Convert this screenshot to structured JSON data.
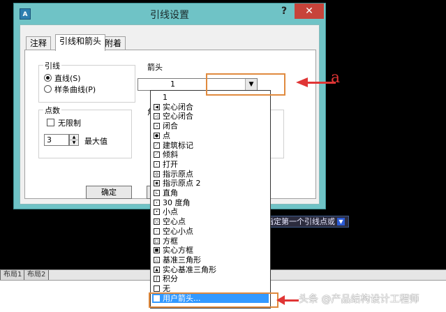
{
  "window": {
    "title": "引线设置",
    "help_label": "?",
    "close_label": "✕",
    "app_icon": "A"
  },
  "tabs": [
    {
      "label": "注释"
    },
    {
      "label": "引线和箭头"
    },
    {
      "label": "附着"
    }
  ],
  "leader_group": {
    "label": "引线",
    "options": [
      {
        "label": "直线(S)",
        "checked": true
      },
      {
        "label": "样条曲线(P)",
        "checked": false
      }
    ]
  },
  "count_group": {
    "label": "点数",
    "unlimited_label": "无限制",
    "unlimited_checked": false,
    "value": "3",
    "max_label": "最大值"
  },
  "arrow_group": {
    "label": "箭头",
    "combo_value": "1"
  },
  "angle_group": {
    "label_partial": "角"
  },
  "buttons": {
    "ok_label": "确定",
    "cancel_partial": ""
  },
  "dropdown": {
    "items": [
      {
        "label": "1",
        "icon": "none"
      },
      {
        "label": "实心闭合",
        "icon": "solid-closed-arrow-icon"
      },
      {
        "label": "空心闭合",
        "icon": "hollow-closed-arrow-icon"
      },
      {
        "label": "闭合",
        "icon": "closed-arrow-icon"
      },
      {
        "label": "点",
        "icon": "dot-icon"
      },
      {
        "label": "建筑标记",
        "icon": "architectural-tick-icon"
      },
      {
        "label": "倾斜",
        "icon": "oblique-icon"
      },
      {
        "label": "打开",
        "icon": "open-arrow-icon"
      },
      {
        "label": "指示原点",
        "icon": "origin-indicator-icon"
      },
      {
        "label": "指示原点 2",
        "icon": "origin-indicator-2-icon"
      },
      {
        "label": "直角",
        "icon": "right-angle-icon"
      },
      {
        "label": "30 度角",
        "icon": "open-30-icon"
      },
      {
        "label": "小点",
        "icon": "small-dot-icon"
      },
      {
        "label": "空心点",
        "icon": "hollow-dot-icon"
      },
      {
        "label": "空心小点",
        "icon": "small-hollow-dot-icon"
      },
      {
        "label": "方框",
        "icon": "box-icon"
      },
      {
        "label": "实心方框",
        "icon": "filled-box-icon"
      },
      {
        "label": "基准三角形",
        "icon": "datum-triangle-icon"
      },
      {
        "label": "实心基准三角形",
        "icon": "filled-datum-triangle-icon"
      },
      {
        "label": "积分",
        "icon": "integral-icon"
      },
      {
        "label": "无",
        "icon": "none-icon"
      },
      {
        "label": "用户箭头...",
        "icon": "user-arrow-icon",
        "selected": true
      }
    ]
  },
  "cad": {
    "tooltip": "指定第一个引线点或",
    "layout_tabs": [
      "布局1",
      "布局2"
    ]
  },
  "annotation": {
    "letter": "a"
  },
  "watermark": "头条 @产品结构设计工程师",
  "colors": {
    "dialog_frame": "#6fc3c6",
    "close_button": "#c7433a",
    "highlight_box": "#e08a3e",
    "annotation_arrow": "#e03535",
    "selected_item": "#3399ff"
  }
}
